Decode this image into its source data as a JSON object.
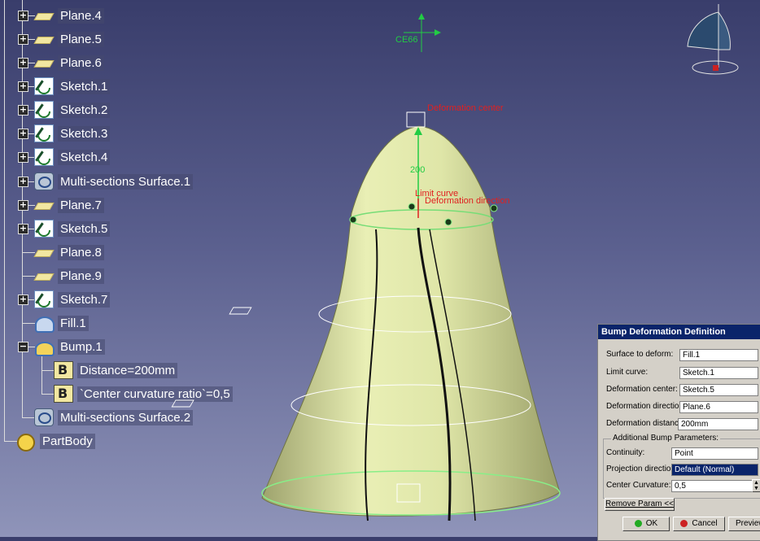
{
  "tree": {
    "items": [
      {
        "label": "Plane.4",
        "icon": "plane-icon"
      },
      {
        "label": "Plane.5",
        "icon": "plane-icon"
      },
      {
        "label": "Plane.6",
        "icon": "plane-icon"
      },
      {
        "label": "Sketch.1",
        "icon": "sketch-icon"
      },
      {
        "label": "Sketch.2",
        "icon": "sketch-icon"
      },
      {
        "label": "Sketch.3",
        "icon": "sketch-icon"
      },
      {
        "label": "Sketch.4",
        "icon": "sketch-icon"
      },
      {
        "label": "Multi-sections Surface.1",
        "icon": "multi-section-surface-icon"
      },
      {
        "label": "Plane.7",
        "icon": "plane-icon"
      },
      {
        "label": "Sketch.5",
        "icon": "sketch-icon"
      },
      {
        "label": "Plane.8",
        "icon": "plane-icon"
      },
      {
        "label": "Plane.9",
        "icon": "plane-icon"
      },
      {
        "label": "Sketch.7",
        "icon": "sketch-icon"
      },
      {
        "label": "Fill.1",
        "icon": "fill-icon"
      },
      {
        "label": "Bump.1",
        "icon": "bump-icon"
      },
      {
        "label": "Distance=200mm",
        "icon": "parameter-icon"
      },
      {
        "label": "`Center curvature ratio`=0,5",
        "icon": "parameter-icon"
      },
      {
        "label": "Multi-sections Surface.2",
        "icon": "multi-section-surface-icon"
      },
      {
        "label": "PartBody",
        "icon": "partbody-icon"
      }
    ]
  },
  "viewport": {
    "top_label": "CE66",
    "deformation_center_label": "Deformation center",
    "dimension_value": "200",
    "limit_curve_label": "Limit curve",
    "deformation_direction_label": "Deformation direction"
  },
  "dialog": {
    "title": "Bump Deformation Definition",
    "fields": {
      "surface_label": "Surface to deform:",
      "surface_value": "Fill.1",
      "limit_label": "Limit curve:",
      "limit_value": "Sketch.1",
      "center_label": "Deformation center:",
      "center_value": "Sketch.5",
      "direction_label": "Deformation direction:",
      "direction_value": "Plane.6",
      "distance_label": "Deformation distance:",
      "distance_value": "200mm"
    },
    "additional": {
      "title": "Additional Bump Parameters:",
      "continuity_label": "Continuity:",
      "continuity_value": "Point",
      "projection_label": "Projection direction:",
      "projection_value": "Default (Normal)",
      "curvature_label": "Center Curvature:",
      "curvature_value": "0,5"
    },
    "buttons": {
      "remove": "Remove Param <<",
      "ok": "OK",
      "cancel": "Cancel",
      "preview": "Preview"
    }
  },
  "colors": {
    "background_top": "#393d6b",
    "background_bottom": "#8f94b9",
    "surface": "#dfe6a8",
    "dialog_title": "#0a246a",
    "annotation_red": "#e02020",
    "axis_green": "#22cc44"
  }
}
